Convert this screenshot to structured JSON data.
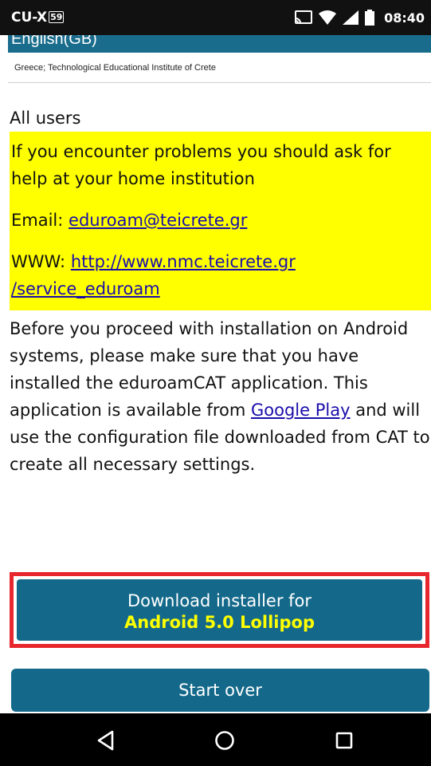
{
  "status_bar": {
    "carrier": "CU-X",
    "carrier_badge": "59",
    "time": "08:40"
  },
  "header": {
    "language": "English(GB)",
    "institution": "Greece; Technological Educational Institute of Crete"
  },
  "content": {
    "audience": "All users",
    "support": {
      "message": "If you encounter problems you should ask for help at your home institution",
      "email_label": "Email:",
      "email": "eduroam@teicrete.gr",
      "www_label": "WWW:",
      "www_line1": "http://www.nmc.teicrete.gr",
      "www_line2": "/service_eduroam"
    },
    "install_text_before": "Before you proceed with installation on Android systems, please make sure that you have installed the eduroamCAT application. This application is available from",
    "google_play_link": "Google Play",
    "install_text_after": "and will use the configuration file downloaded from CAT to create all necessary settings."
  },
  "buttons": {
    "download_line1": "Download installer for",
    "download_line2": "Android 5.0 Lollipop",
    "start_over": "Start over"
  },
  "colors": {
    "accent_blue": "#14698a",
    "highlight_yellow": "#ffff00",
    "selection_red": "#e8262e",
    "link_blue": "#1a0dab"
  },
  "icons": {
    "status": [
      "cast-icon",
      "wifi-icon",
      "cell-signal-icon",
      "battery-icon"
    ],
    "nav": [
      "back-icon",
      "home-icon",
      "recent-apps-icon"
    ]
  }
}
